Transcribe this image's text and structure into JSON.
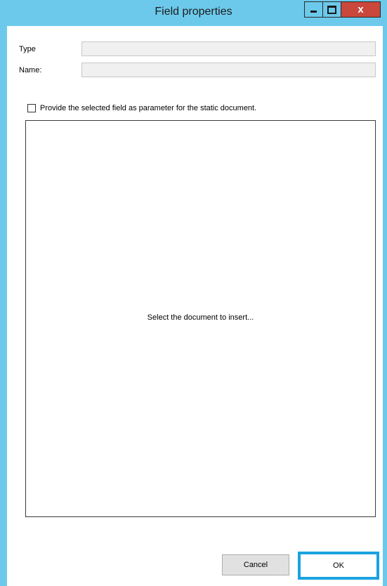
{
  "window": {
    "title": "Field properties",
    "close_glyph": "x"
  },
  "form": {
    "type_label": "Type",
    "type_value": "",
    "name_label": "Name:",
    "name_value": ""
  },
  "option": {
    "checkbox_label": "Provide the selected field as parameter for the static document.",
    "checked": false
  },
  "document": {
    "placeholder": "Select the document to insert..."
  },
  "buttons": {
    "cancel": "Cancel",
    "ok": "OK"
  },
  "colors": {
    "titlebar": "#6cc9eb",
    "close": "#c9473b",
    "ok_highlight": "#1aa3e0"
  }
}
